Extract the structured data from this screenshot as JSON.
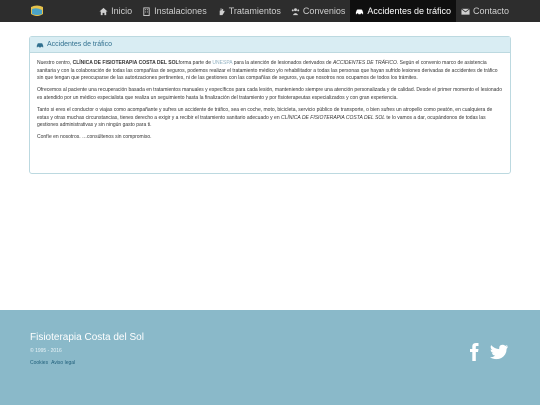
{
  "nav": {
    "items": [
      {
        "label": "Inicio",
        "icon": "home-icon"
      },
      {
        "label": "Instalaciones",
        "icon": "building-icon"
      },
      {
        "label": "Tratamientos",
        "icon": "hand-icon"
      },
      {
        "label": "Convenios",
        "icon": "users-icon"
      },
      {
        "label": "Accidentes de tráfico",
        "icon": "car-icon",
        "active": true
      },
      {
        "label": "Contacto",
        "icon": "envelope-icon"
      }
    ]
  },
  "panel": {
    "heading": "Accidentes de tráfico",
    "p1": {
      "t1": "Nuestro centro, ",
      "b1": "CLÍNICA DE FISIOTERAPIA COSTA DEL SOL",
      "t2": "forma parte de ",
      "link": "UNESPA",
      "t3": " para la atención de lesionados derivados de ",
      "i1": "ACCIDENTES DE TRÁFICO",
      "t4": ". Según el convenio marco de asistencia sanitaria y con la colaboración de todas las compañías de seguros, podemos realizar el tratamiento médico y/o rehabilitador a todas las personas que hayan sufrido lesiones derivadas de accidentes de tráfico sin que tengan que preocuparse de las autorizaciones pertinentes, ni de las gestiones con las compañías de seguros, ya que nosotros nos ocupamos de todos los trámites."
    },
    "p2": "Ofrecemos al paciente una recuperación basada en tratamientos manuales y específicos para cada lesión, manteniendo siempre una atención personalizada y de calidad. Desde el primer momento el lesionado es atendido por un médico especialista que realiza un seguimiento hasta la finalización del tratamiento y por fisioterapeutas especializados y con gran experiencia.",
    "p3": {
      "t1": "Tanto si eres el conductor o viajas como acompañante y sufres un accidente de tráfico, sea en coche, moto, bicicleta, servicio público de transporte, o bien sufres un atropello como peatón, en cualquiera de estas y otras muchas circunstancias, tienes derecho a exigir y a recibir el tratamiento sanitario adecuado y en ",
      "i1": "CLÍNICA DE FISIOTERAPIA COSTA DEL SOL",
      "t2": " te lo vamos a dar, ocupándonos de todas las gestiones administrativas y sin ningún gasto para ti."
    },
    "p4": "Confíe en nosotros. …consúltenos sin compromiso."
  },
  "footer": {
    "title": "Fisioterapia Costa del Sol",
    "copyright": "© 1995 - 2016",
    "links": [
      "Cookies",
      "Aviso legal"
    ],
    "social": [
      "facebook-icon",
      "twitter-icon"
    ]
  },
  "colors": {
    "navbar": "#2d2d2d",
    "nav_active": "#0f0f0f",
    "panel_heading_bg": "#d9edf3",
    "panel_heading_text": "#31708f",
    "footer_bg": "#8ab9c9"
  }
}
